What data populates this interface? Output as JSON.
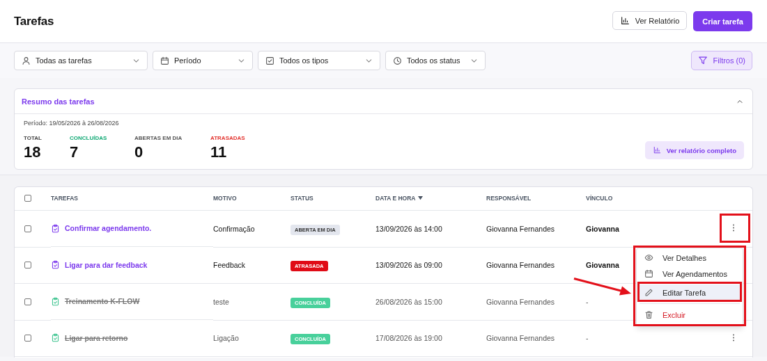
{
  "header": {
    "title": "Tarefas",
    "buttons": [
      {
        "label": "Ver Relatório",
        "kind": "secondary"
      },
      {
        "label": "Criar tarefa",
        "kind": "primary"
      }
    ]
  },
  "filters": [
    {
      "label": "Todas as tarefas",
      "kind": "user"
    },
    {
      "label": "Período",
      "kind": "calendar"
    },
    {
      "label": "Todos os tipos",
      "kind": "check"
    },
    {
      "label": "Todos os status",
      "kind": "clock"
    }
  ],
  "filters_button": {
    "label": "Filtros (0)"
  },
  "summary": {
    "title": "Resumo das tarefas",
    "expanded": true,
    "period": "Período: 19/05/2026 à 26/08/2026",
    "stats": [
      {
        "label": "TOTAL",
        "value": "18",
        "kind": "total"
      },
      {
        "label": "CONCLUÍDAS",
        "value": "7",
        "kind": "done"
      },
      {
        "label": "ABERTAS EM DIA",
        "value": "0",
        "kind": "open"
      },
      {
        "label": "ATRASADAS",
        "value": "11",
        "kind": "late"
      }
    ],
    "report_button": "Ver relatório completo"
  },
  "table": {
    "select_all_checked": false,
    "columns": [
      {
        "label": "TAREFAS"
      },
      {
        "label": "MOTIVO"
      },
      {
        "label": "STATUS"
      },
      {
        "label": "DATA E HORA",
        "sorted_desc": true
      },
      {
        "label": "RESPONSÁVEL"
      },
      {
        "label": "VÍNCULO"
      }
    ],
    "rows": [
      {
        "checked": false,
        "task": "Confirmar agendamento.",
        "done": false,
        "motivo": "Confirmação",
        "status": {
          "label": "ABERTA EM DIA",
          "kind": "open"
        },
        "datetime": "13/09/2026 às 14:00",
        "responsavel": "Giovanna Fernandes",
        "vinculo": "Giovanna"
      },
      {
        "checked": false,
        "task": "Ligar para dar feedback",
        "done": false,
        "motivo": "Feedback",
        "status": {
          "label": "ATRASADA",
          "kind": "late"
        },
        "datetime": "13/09/2026 às 09:00",
        "responsavel": "Giovanna Fernandes",
        "vinculo": "Giovanna"
      },
      {
        "checked": false,
        "task": "Treinamento K-FLOW",
        "done": true,
        "motivo": "teste",
        "status": {
          "label": "CONCLUÍDA",
          "kind": "done"
        },
        "datetime": "26/08/2026 às 15:00",
        "responsavel": "Giovanna Fernandes",
        "vinculo": "-"
      },
      {
        "checked": false,
        "task": "Ligar para retorno",
        "done": true,
        "motivo": "Ligação",
        "status": {
          "label": "CONCLUÍDA",
          "kind": "done"
        },
        "datetime": "17/08/2026 às 19:00",
        "responsavel": "Giovanna Fernandes",
        "vinculo": "-"
      }
    ]
  },
  "row_menu": {
    "items": [
      {
        "label": "Ver Detalhes",
        "kind": "eye",
        "selected": false
      },
      {
        "label": "Ver Agendamentos",
        "kind": "calendar",
        "selected": false
      },
      {
        "label": "Editar Tarefa",
        "kind": "pencil",
        "selected": true
      },
      {
        "label": "Excluir",
        "kind": "trash",
        "selected": false,
        "danger": true
      }
    ]
  }
}
